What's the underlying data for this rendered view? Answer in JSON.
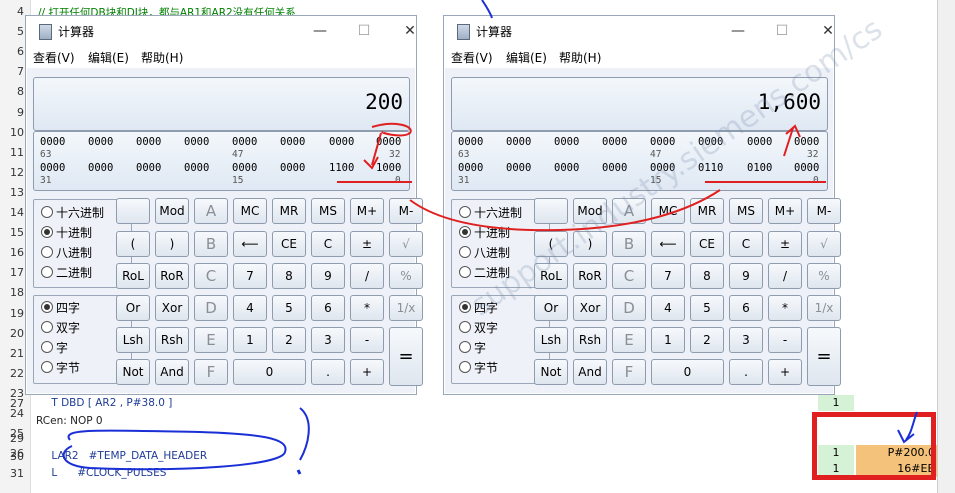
{
  "editor": {
    "lines": [
      {
        "n": "4",
        "text": "// 打开任何DB块和DI块，都与AR1和AR2没有任何关系",
        "kind": "comment"
      },
      {
        "n": "5",
        "text": "",
        "kind": "code"
      },
      {
        "n": "6",
        "text": "",
        "kind": "code"
      },
      {
        "n": "7",
        "text": "",
        "kind": "code"
      },
      {
        "n": "8",
        "text": "",
        "kind": "code"
      },
      {
        "n": "9",
        "text": "",
        "kind": "code"
      },
      {
        "n": "10",
        "text": "",
        "kind": "code"
      },
      {
        "n": "11",
        "text": "",
        "kind": "code"
      },
      {
        "n": "12",
        "text": "",
        "kind": "code"
      },
      {
        "n": "13",
        "text": "",
        "kind": "code"
      },
      {
        "n": "14",
        "text": "",
        "kind": "code"
      },
      {
        "n": "15",
        "text": "",
        "kind": "code"
      },
      {
        "n": "16",
        "text": "",
        "kind": "code"
      },
      {
        "n": "17",
        "text": "",
        "kind": "code"
      },
      {
        "n": "18",
        "text": "",
        "kind": "code"
      },
      {
        "n": "19",
        "text": "",
        "kind": "code"
      },
      {
        "n": "20",
        "text": "",
        "kind": "code"
      },
      {
        "n": "21",
        "text": "",
        "kind": "code"
      },
      {
        "n": "22",
        "text": "",
        "kind": "code"
      },
      {
        "n": "23",
        "text": "",
        "kind": "code"
      },
      {
        "n": "24",
        "text": "",
        "kind": "code"
      },
      {
        "n": "25",
        "text": "",
        "kind": "code"
      },
      {
        "n": "26",
        "text": "",
        "kind": "code"
      },
      {
        "n": "27",
        "text": "    T DBD [ AR2 , P#38.0 ]",
        "kind": "code"
      },
      {
        "n": "",
        "text": "RCen: NOP 0",
        "kind": "label"
      },
      {
        "n": "29",
        "text": "",
        "kind": "code"
      },
      {
        "n": "30",
        "text": "    LAR2   #TEMP_DATA_HEADER",
        "kind": "code"
      },
      {
        "n": "31",
        "text": "    L      #CLOCK_PULSES",
        "kind": "code"
      }
    ],
    "right_panel": {
      "rows": [
        {
          "left": "1",
          "right": ""
        },
        {
          "left": "1",
          "right": "P#200.0"
        },
        {
          "left": "1",
          "right": "16#EB"
        }
      ]
    }
  },
  "calculators": [
    {
      "id": "left",
      "title": "计算器",
      "minimize": "—",
      "maximize": "☐",
      "close": "✕",
      "menu": [
        "查看(V)",
        "编辑(E)",
        "帮助(H)"
      ],
      "display": "200",
      "bits_row1": [
        "0000",
        "0000",
        "0000",
        "0000",
        "0000",
        "0000",
        "0000",
        "0000"
      ],
      "pos_row1": [
        "63",
        "47",
        "32"
      ],
      "bits_row2": [
        "0000",
        "0000",
        "0000",
        "0000",
        "0000",
        "0000",
        "1100",
        "1000"
      ],
      "pos_row2": [
        "31",
        "15",
        "0"
      ],
      "radix": [
        "十六进制",
        "十进制",
        "八进制",
        "二进制"
      ],
      "radix_selected": 1,
      "word": [
        "四字",
        "双字",
        "字",
        "字节"
      ],
      "word_selected": 0,
      "buttons": {
        "quot": "",
        "mod": "Mod",
        "a": "A",
        "mc": "MC",
        "mr": "MR",
        "ms": "MS",
        "mplus": "M+",
        "mminus": "M-",
        "lparen": "(",
        "rparen": ")",
        "b": "B",
        "back": "⟵",
        "ce": "CE",
        "c": "C",
        "pm": "±",
        "sqrt": "√",
        "rol": "RoL",
        "ror": "RoR",
        "cc": "C",
        "n7": "7",
        "n8": "8",
        "n9": "9",
        "div": "/",
        "pct": "%",
        "or": "Or",
        "xor": "Xor",
        "d": "D",
        "n4": "4",
        "n5": "5",
        "n6": "6",
        "mul": "*",
        "recip": "1/x",
        "lsh": "Lsh",
        "rsh": "Rsh",
        "e": "E",
        "n1": "1",
        "n2": "2",
        "n3": "3",
        "minus": "-",
        "eq": "=",
        "not": "Not",
        "and": "And",
        "f": "F",
        "n0": "0",
        "dot": ".",
        "plus": "+"
      }
    },
    {
      "id": "right",
      "title": "计算器",
      "minimize": "—",
      "maximize": "☐",
      "close": "✕",
      "menu": [
        "查看(V)",
        "编辑(E)",
        "帮助(H)"
      ],
      "display": "1,600",
      "bits_row1": [
        "0000",
        "0000",
        "0000",
        "0000",
        "0000",
        "0000",
        "0000",
        "0000"
      ],
      "pos_row1": [
        "63",
        "47",
        "32"
      ],
      "bits_row2": [
        "0000",
        "0000",
        "0000",
        "0000",
        "0000",
        "0110",
        "0100",
        "0000"
      ],
      "pos_row2": [
        "31",
        "15",
        "0"
      ],
      "radix": [
        "十六进制",
        "十进制",
        "八进制",
        "二进制"
      ],
      "radix_selected": 1,
      "word": [
        "四字",
        "双字",
        "字",
        "字节"
      ],
      "word_selected": 0,
      "buttons": {
        "quot": "",
        "mod": "Mod",
        "a": "A",
        "mc": "MC",
        "mr": "MR",
        "ms": "MS",
        "mplus": "M+",
        "mminus": "M-",
        "lparen": "(",
        "rparen": ")",
        "b": "B",
        "back": "⟵",
        "ce": "CE",
        "c": "C",
        "pm": "±",
        "sqrt": "√",
        "rol": "RoL",
        "ror": "RoR",
        "cc": "C",
        "n7": "7",
        "n8": "8",
        "n9": "9",
        "div": "/",
        "pct": "%",
        "or": "Or",
        "xor": "Xor",
        "d": "D",
        "n4": "4",
        "n5": "5",
        "n6": "6",
        "mul": "*",
        "recip": "1/x",
        "lsh": "Lsh",
        "rsh": "Rsh",
        "e": "E",
        "n1": "1",
        "n2": "2",
        "n3": "3",
        "minus": "-",
        "eq": "=",
        "not": "Not",
        "and": "And",
        "f": "F",
        "n0": "0",
        "dot": ".",
        "plus": "+"
      }
    }
  ],
  "colors": {
    "annotation_red": "#e02020",
    "annotation_blue": "#1a2fd6",
    "code_blue": "#1e3c96",
    "comment_green": "#008000"
  }
}
